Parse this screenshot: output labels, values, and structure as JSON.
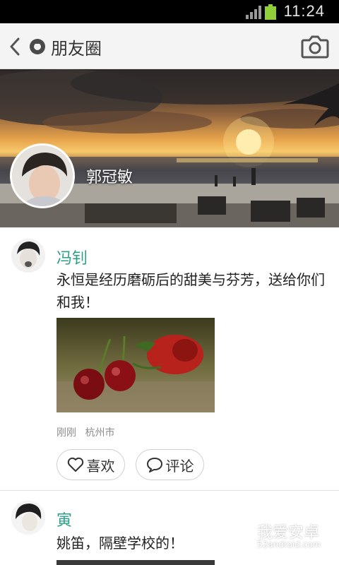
{
  "status_bar": {
    "time": "11:24",
    "battery_color": "#8fcf3a"
  },
  "header": {
    "title": "朋友圈",
    "back_icon": "chevron-left-icon",
    "app_icon": "moments-icon",
    "camera_icon": "camera-icon"
  },
  "cover": {
    "user_name": "郭冠敏"
  },
  "posts": [
    {
      "author": "冯钊",
      "text": "永恒是经历磨砺后的甜美与芬芳，送给你们和我！",
      "time": "刚刚",
      "location": "杭州市",
      "like_label": "喜欢",
      "comment_label": "评论"
    },
    {
      "author": "寅",
      "text": "姚笛，隔壁学校的！"
    }
  ],
  "watermark": {
    "text": "我爱安卓",
    "sub": "52android.com"
  },
  "colors": {
    "author_name": "#2d9f87",
    "title_bar": "#f4f4f4"
  }
}
